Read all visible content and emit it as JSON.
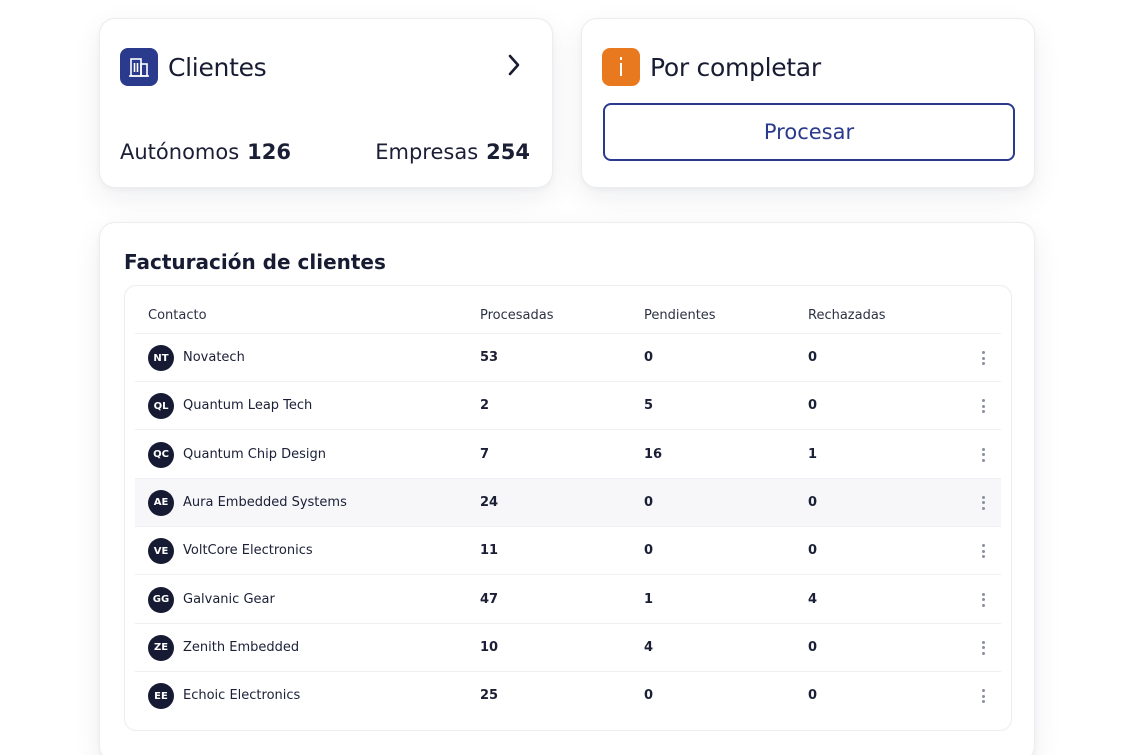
{
  "clients_card": {
    "icon": "building-icon",
    "title": "Clientes",
    "autonomos_label": "Autónomos",
    "autonomos_count": "126",
    "empresas_label": "Empresas",
    "empresas_count": "254"
  },
  "pending_card": {
    "icon": "info-icon",
    "title": "Por completar",
    "process_label": "Procesar"
  },
  "billing": {
    "title": "Facturación de clientes",
    "columns": [
      "Contacto",
      "Procesadas",
      "Pendientes",
      "Rechazadas"
    ],
    "rows": [
      {
        "initials": "NT",
        "name": "Novatech",
        "procesadas": "53",
        "pendientes": "0",
        "rechazadas": "0"
      },
      {
        "initials": "QL",
        "name": "Quantum Leap Tech",
        "procesadas": "2",
        "pendientes": "5",
        "rechazadas": "0"
      },
      {
        "initials": "QC",
        "name": "Quantum Chip Design",
        "procesadas": "7",
        "pendientes": "16",
        "rechazadas": "1"
      },
      {
        "initials": "AE",
        "name": "Aura Embedded Systems",
        "procesadas": "24",
        "pendientes": "0",
        "rechazadas": "0"
      },
      {
        "initials": "VE",
        "name": "VoltCore Electronics",
        "procesadas": "11",
        "pendientes": "0",
        "rechazadas": "0"
      },
      {
        "initials": "GG",
        "name": "Galvanic Gear",
        "procesadas": "47",
        "pendientes": "1",
        "rechazadas": "4"
      },
      {
        "initials": "ZE",
        "name": "Zenith Embedded",
        "procesadas": "10",
        "pendientes": "4",
        "rechazadas": "0"
      },
      {
        "initials": "EE",
        "name": "Echoic Electronics",
        "procesadas": "25",
        "pendientes": "0",
        "rechazadas": "0"
      }
    ]
  },
  "colors": {
    "brand_blue": "#2a3a8c",
    "accent_orange": "#e9791e",
    "avatar_bg": "#161a33",
    "highlight_row": "#f7f7f9"
  }
}
